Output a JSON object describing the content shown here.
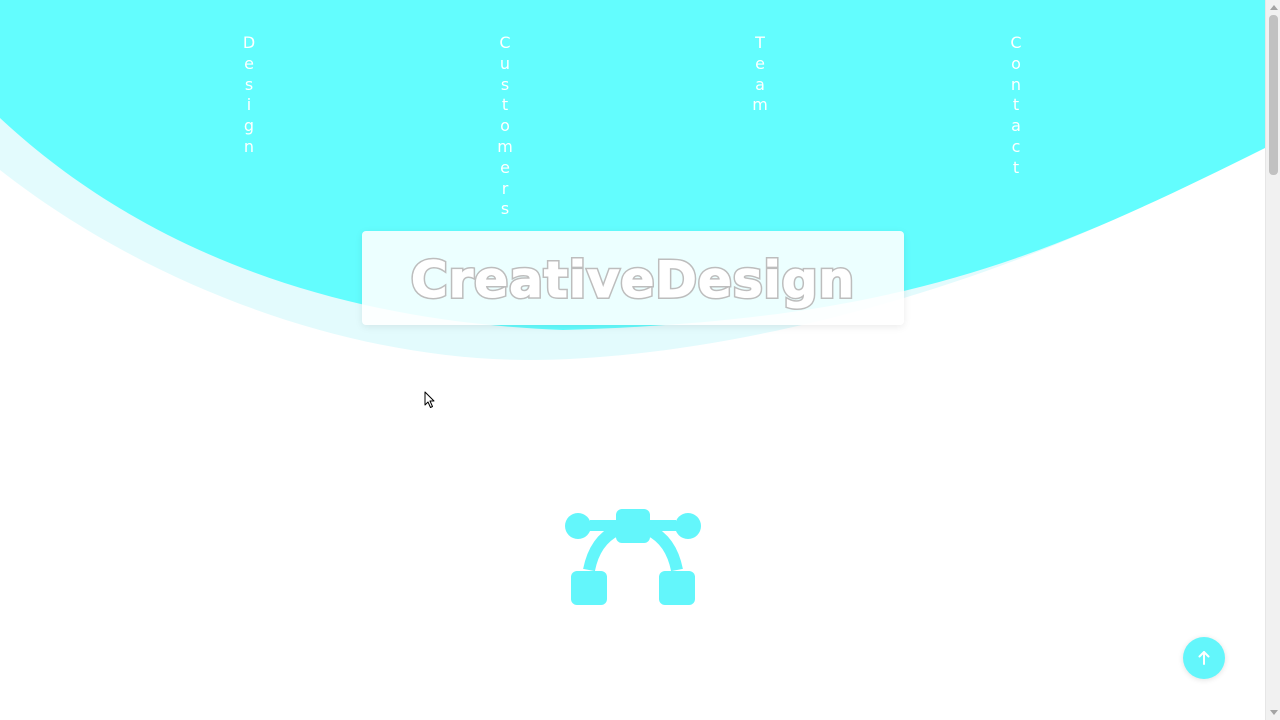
{
  "nav": {
    "items": [
      {
        "label": "Design"
      },
      {
        "label": "Customers"
      },
      {
        "label": "Team"
      },
      {
        "label": "Contact"
      }
    ]
  },
  "hero": {
    "title": "CreativeDesign",
    "accent_color": "#63f6fb"
  },
  "icons": {
    "logo": "vector-path-icon",
    "scroll_top": "arrow-up-icon"
  }
}
